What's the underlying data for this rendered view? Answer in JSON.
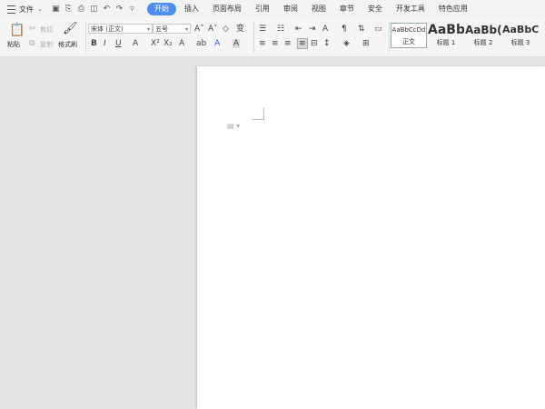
{
  "menubar": {
    "file_label": "文件",
    "tabs": [
      {
        "label": "开始",
        "active": true
      },
      {
        "label": "插入"
      },
      {
        "label": "页面布局"
      },
      {
        "label": "引用"
      },
      {
        "label": "审阅"
      },
      {
        "label": "视图"
      },
      {
        "label": "章节"
      },
      {
        "label": "安全"
      },
      {
        "label": "开发工具"
      },
      {
        "label": "特色应用"
      }
    ],
    "accent_color": "#4d8ef5"
  },
  "ribbon": {
    "paste_label": "粘贴",
    "cut_label": "剪切",
    "copy_label": "复制",
    "format_painter_label": "格式刷",
    "font_name": "宋体 (正文)",
    "font_size": "五号",
    "styles": [
      {
        "preview": "AaBbCcDd",
        "name": "正文"
      },
      {
        "preview": "AaBb",
        "name": "标题 1"
      },
      {
        "preview": "AaBb(",
        "name": "标题 2"
      },
      {
        "preview": "AaBbC",
        "name": "标题 3"
      }
    ]
  }
}
